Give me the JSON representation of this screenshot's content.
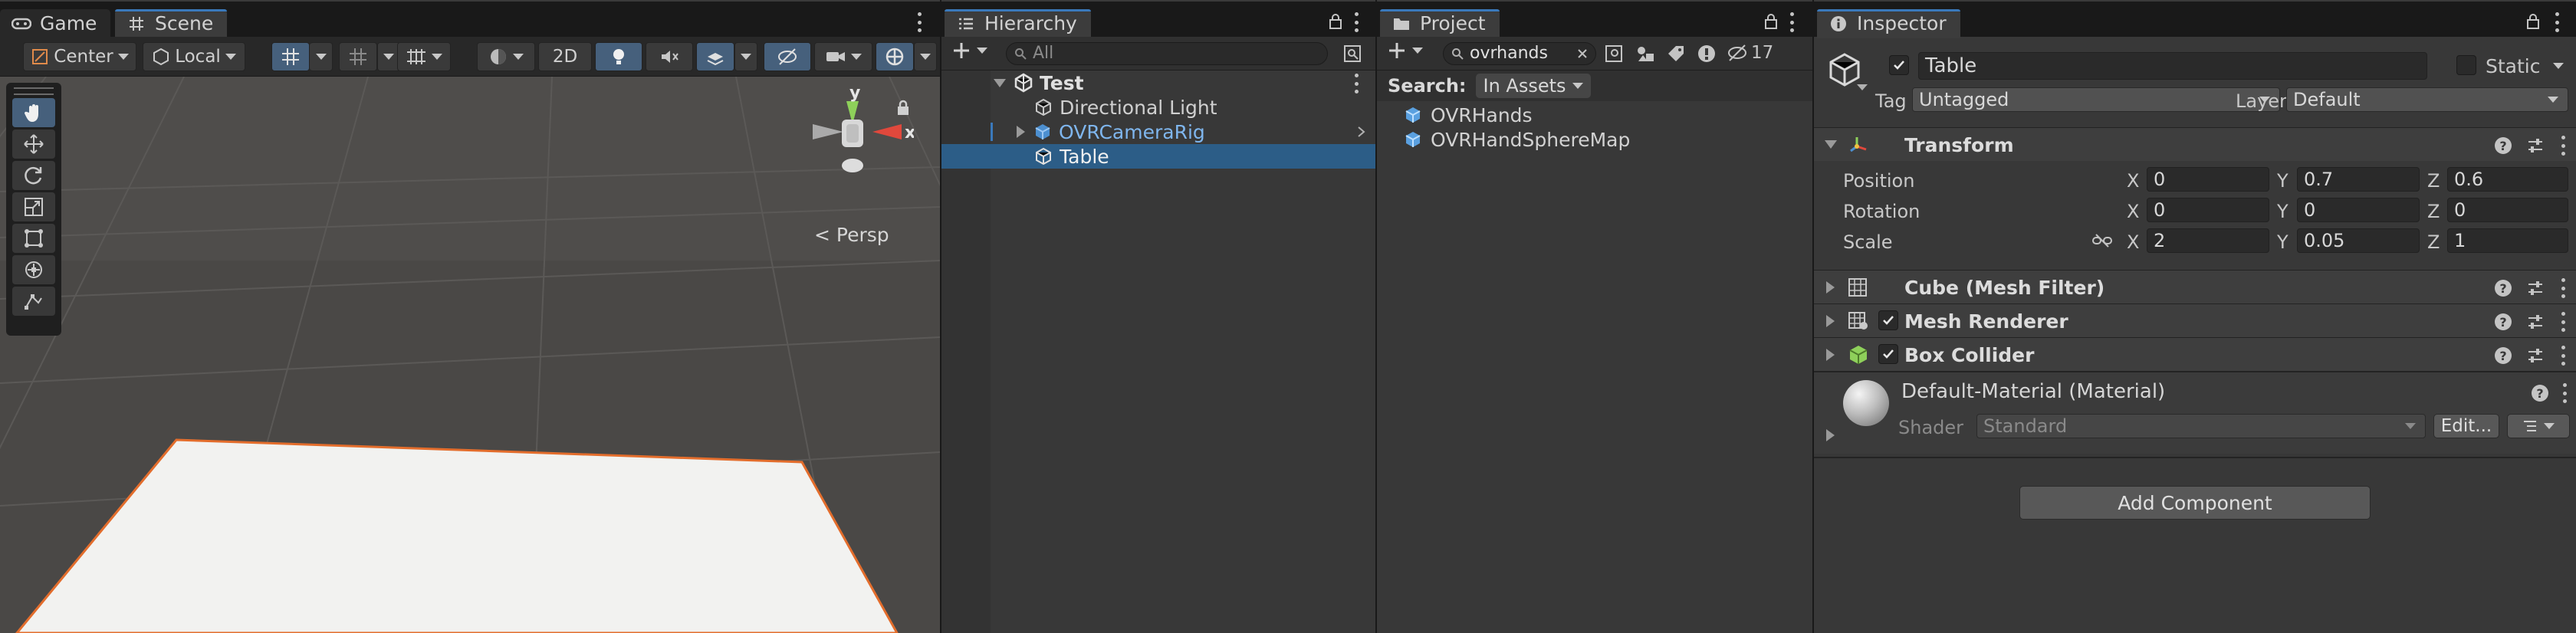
{
  "scene_panel": {
    "tabs": [
      {
        "label": "Game"
      },
      {
        "label": "Scene"
      }
    ],
    "toolbar": {
      "pivot_label": "Center",
      "space_label": "Local",
      "mode_2d_label": "2D"
    },
    "view_label": "Persp",
    "gizmo_axes": {
      "y": "y",
      "x": "x"
    }
  },
  "hierarchy": {
    "tab_label": "Hierarchy",
    "search_placeholder": "All",
    "rows": [
      {
        "label": "Test"
      },
      {
        "label": "Directional Light"
      },
      {
        "label": "OVRCameraRig"
      },
      {
        "label": "Table"
      }
    ]
  },
  "project": {
    "tab_label": "Project",
    "search_value": "ovrhands",
    "hidden_count": "17",
    "search_label": "Search:",
    "scope_label": "In Assets",
    "assets": [
      {
        "label": "OVRHands"
      },
      {
        "label": "OVRHandSphereMap"
      }
    ]
  },
  "inspector": {
    "tab_label": "Inspector",
    "object_name": "Table",
    "static_label": "Static",
    "tag_label": "Tag",
    "tag_value": "Untagged",
    "layer_label": "Layer",
    "layer_value": "Default",
    "transform": {
      "title": "Transform",
      "position_label": "Position",
      "rotation_label": "Rotation",
      "scale_label": "Scale",
      "axis_x": "X",
      "axis_y": "Y",
      "axis_z": "Z",
      "position": {
        "x": "0",
        "y": "0.7",
        "z": "0.6"
      },
      "rotation": {
        "x": "0",
        "y": "0",
        "z": "0"
      },
      "scale": {
        "x": "2",
        "y": "0.05",
        "z": "1"
      }
    },
    "components": [
      {
        "title": "Cube (Mesh Filter)"
      },
      {
        "title": "Mesh Renderer"
      },
      {
        "title": "Box Collider"
      }
    ],
    "material": {
      "title": "Default-Material (Material)",
      "shader_label": "Shader",
      "shader_value": "Standard",
      "edit_label": "Edit..."
    },
    "add_component_label": "Add Component"
  },
  "colors": {
    "accent": "#3a79bb",
    "selection": "#2c5d87",
    "prefab_blue": "#7fb6ee",
    "outline_orange": "#e36d2c"
  }
}
